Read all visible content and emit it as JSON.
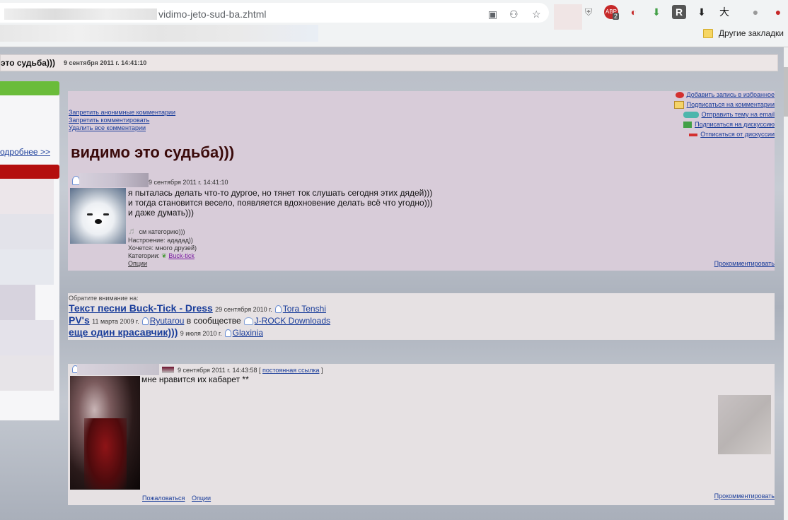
{
  "browser": {
    "url_text": "vidimo-jeto-sud-ba.zhtml",
    "extension_badge": "2",
    "bookmarks": {
      "other_label": "Другие закладки"
    }
  },
  "title_bar": {
    "title": "это судьба)))",
    "date": "9 сентября 2011 г. 14:41:10"
  },
  "sidebar": {
    "more_link": "одробнее >>"
  },
  "post": {
    "admin_links": [
      "Запретить анонимные комментарии",
      "Запретить комментировать",
      "Удалить все комментарии"
    ],
    "actions": [
      "Добавить запись в избранное",
      "Подписаться на комментарии",
      "Отправить тему на email",
      "Подписаться на дискуссию",
      "Отписаться от дискуссии"
    ],
    "title": "видимо это судьба)))",
    "date": "9 сентября 2011 г. 14:41:10",
    "lines": [
      "я пыталась делать что-то дургое, но тянет ток слушать сегодня этих дядей)))",
      "и тогда становится весело, появляется вдохновение делать всё что угодно)))",
      "и даже думать)))"
    ],
    "music": "см категорию)))",
    "mood": "Настроение: ададад))",
    "want": "Хочется: много друзей)",
    "categories_label": "Категории:",
    "category": "Buck-tick",
    "options": "Опции",
    "comment_link": "Прокомментировать"
  },
  "notice": {
    "label": "Обратите внимание на:",
    "items": [
      {
        "title": "Текст песни Buck-Tick - Dress",
        "date": "29 сентября 2010 г.",
        "user": "Tora Tenshi",
        "prefix": ""
      },
      {
        "title": "PV's",
        "date": "11 марта 2009 г.",
        "user": "Ryutarou",
        "community_text": "в сообществе",
        "community": "J-ROCK Downloads"
      },
      {
        "title": "еще один красавчик)))",
        "date": "9 июля 2010 г.",
        "user": "Glaxinia"
      }
    ]
  },
  "comment": {
    "date": "9 сентября 2011 г. 14:43:58",
    "permalink_open": "[",
    "permalink": "постоянная ссылка",
    "permalink_close": "]",
    "text": "мне нравится их кабарет **",
    "report": "Пожаловаться",
    "options": "Опции",
    "comment_link": "Прокомментировать"
  }
}
